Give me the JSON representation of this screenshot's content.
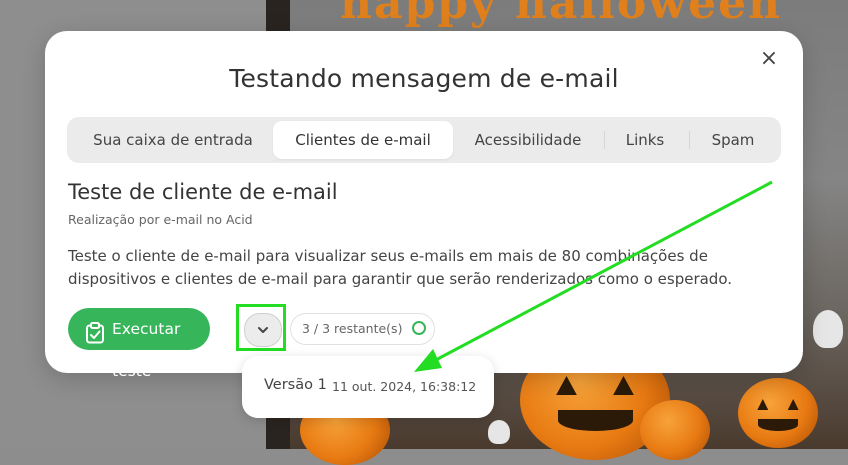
{
  "background": {
    "poster_title": "happy halloween"
  },
  "modal": {
    "title": "Testando mensagem de e-mail",
    "close_symbol": "×",
    "tabs": [
      {
        "label": "Sua caixa de entrada",
        "active": false
      },
      {
        "label": "Clientes de e-mail",
        "active": true
      },
      {
        "label": "Acessibilidade",
        "active": false
      },
      {
        "label": "Links",
        "active": false
      },
      {
        "label": "Spam",
        "active": false
      }
    ],
    "section": {
      "title": "Teste de cliente de e-mail",
      "subtitle": "Realização por e-mail no Acid",
      "description": "Teste o cliente de e-mail para visualizar seus e-mails em mais de 80 combinações de dispositivos e clientes de e-mail para garantir que serão renderizados como o esperado."
    },
    "run_button": {
      "label": "Executar teste",
      "icon": "clipboard-check-icon"
    },
    "dropdown_icon": "chevron-down-icon",
    "remaining": {
      "text": "3 / 3 restante(s)"
    }
  },
  "popover": {
    "version": "Versão 1",
    "date": "11 out. 2024, 16:38:12"
  },
  "colors": {
    "accent_green": "#37b55a",
    "annotation_green": "#22dd22"
  }
}
